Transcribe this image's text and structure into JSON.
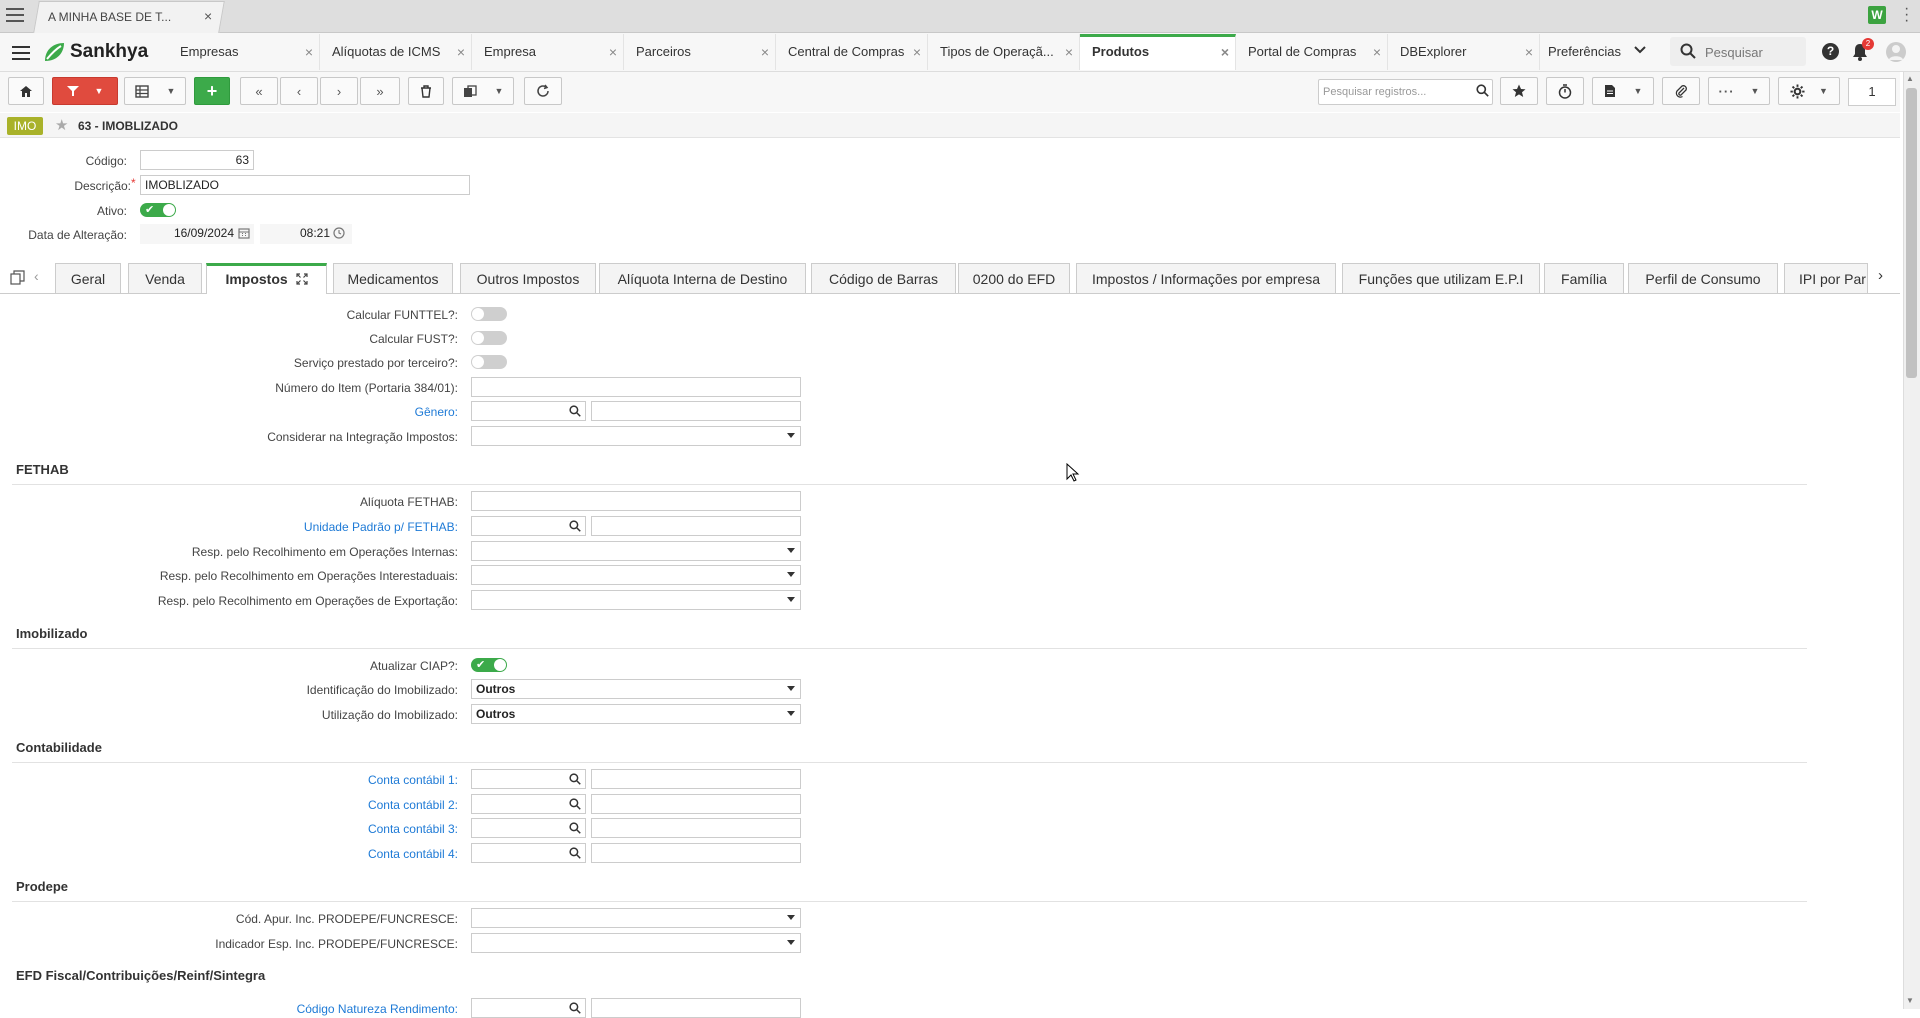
{
  "browser": {
    "tab_title": "A MINHA BASE DE T...",
    "tab_close": "×",
    "extension_label": "W"
  },
  "app": {
    "brand": "Sankhya",
    "tabs": [
      {
        "label": "Empresas"
      },
      {
        "label": "Alíquotas de ICMS"
      },
      {
        "label": "Empresa"
      },
      {
        "label": "Parceiros"
      },
      {
        "label": "Central de Compras"
      },
      {
        "label": "Tipos de Operaçã..."
      },
      {
        "label": "Produtos",
        "active": true
      },
      {
        "label": "Portal de Compras"
      },
      {
        "label": "DBExplorer"
      },
      {
        "label": "Preferências"
      }
    ],
    "search_placeholder": "Pesquisar",
    "notification_count": "2",
    "accent_color": "#3caa4a"
  },
  "toolbar": {
    "search_placeholder": "Pesquisar registros...",
    "page_number": "1"
  },
  "record": {
    "badge": "IMO",
    "title": "63 - IMOBLIZADO"
  },
  "header_form": {
    "codigo_label": "Código:",
    "codigo_value": "63",
    "descricao_label": "Descrição:",
    "descricao_value": "IMOBLIZADO",
    "ativo_label": "Ativo:",
    "ativo_on": true,
    "data_label": "Data de Alteração:",
    "data_value": "16/09/2024",
    "hora_value": "08:21"
  },
  "tabs": [
    {
      "label": "Geral"
    },
    {
      "label": "Venda"
    },
    {
      "label": "Impostos",
      "active": true
    },
    {
      "label": "Medicamentos"
    },
    {
      "label": "Outros Impostos"
    },
    {
      "label": "Alíquota Interna de Destino"
    },
    {
      "label": "Código de Barras"
    },
    {
      "label": "0200 do EFD"
    },
    {
      "label": "Impostos / Informações por empresa"
    },
    {
      "label": "Funções que utilizam E.P.I"
    },
    {
      "label": "Família"
    },
    {
      "label": "Perfil de Consumo"
    },
    {
      "label": "IPI por Par"
    }
  ],
  "impostos": {
    "calc_funttel": "Calcular FUNTTEL?:",
    "calc_fust": "Calcular FUST?:",
    "servico_terceiro": "Serviço prestado por terceiro?:",
    "numero_item": "Número do Item (Portaria 384/01):",
    "genero": "Gênero:",
    "considerar_integracao": "Considerar na Integração Impostos:"
  },
  "sections": {
    "fethab": {
      "title": "FETHAB",
      "aliquota": "Alíquota FETHAB:",
      "unidade": "Unidade Padrão p/ FETHAB:",
      "resp_internas": "Resp. pelo Recolhimento em Operações Internas:",
      "resp_interestaduais": "Resp. pelo Recolhimento em Operações Interestaduais:",
      "resp_exportacao": "Resp. pelo Recolhimento em Operações de Exportação:"
    },
    "imobilizado": {
      "title": "Imobilizado",
      "atualizar_ciap": "Atualizar CIAP?:",
      "atualizar_ciap_on": true,
      "identificacao": "Identificação do Imobilizado:",
      "identificacao_value": "Outros",
      "utilizacao": "Utilização do Imobilizado:",
      "utilizacao_value": "Outros"
    },
    "contabilidade": {
      "title": "Contabilidade",
      "conta1": "Conta contábil 1:",
      "conta2": "Conta contábil 2:",
      "conta3": "Conta contábil 3:",
      "conta4": "Conta contábil 4:"
    },
    "prodepe": {
      "title": "Prodepe",
      "cod_apur": "Cód. Apur. Inc. PRODEPE/FUNCRESCE:",
      "indicador": "Indicador Esp. Inc. PRODEPE/FUNCRESCE:"
    },
    "efd": {
      "title": "EFD Fiscal/Contribuições/Reinf/Sintegra",
      "codigo_natureza": "Código Natureza Rendimento:"
    }
  }
}
